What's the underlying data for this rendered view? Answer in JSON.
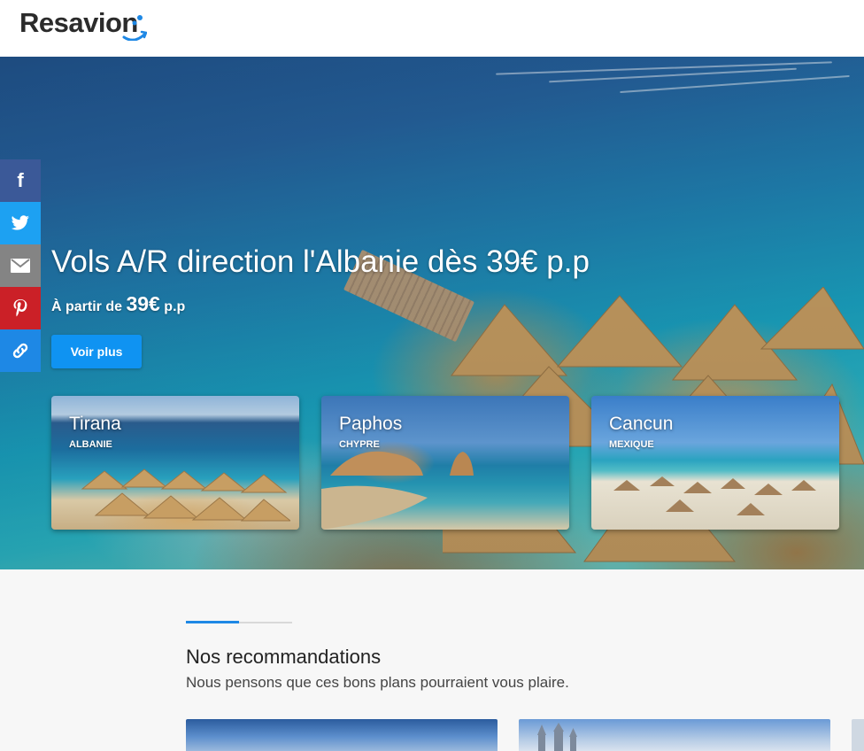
{
  "header": {
    "logo_text": "Resavion"
  },
  "hero": {
    "title": "Vols A/R direction l'Albanie dès 39€ p.p",
    "subtitle_prefix": "À partir de",
    "subtitle_price": "39€",
    "subtitle_suffix": "p.p",
    "cta_label": "Voir plus"
  },
  "destinations": [
    {
      "name": "Tirana",
      "country": "ALBANIE"
    },
    {
      "name": "Paphos",
      "country": "CHYPRE"
    },
    {
      "name": "Cancun",
      "country": "MEXIQUE"
    }
  ],
  "social": {
    "items": [
      {
        "icon": "facebook-icon",
        "glyph": "f",
        "color": "#3b5998"
      },
      {
        "icon": "twitter-icon",
        "glyph": "🐦",
        "color": "#1da1f2"
      },
      {
        "icon": "mail-icon",
        "glyph": "✉",
        "color": "#848484"
      },
      {
        "icon": "pinterest-icon",
        "glyph": "P",
        "color": "#cb2027"
      },
      {
        "icon": "link-icon",
        "glyph": "🔗",
        "color": "#1e88e5"
      }
    ]
  },
  "recommendations": {
    "title": "Nos recommandations",
    "subtitle": "Nous pensons que ces bons plans pourraient vous plaire."
  },
  "colors": {
    "accent": "#0f93f2",
    "section_accent": "#1e88e5"
  }
}
